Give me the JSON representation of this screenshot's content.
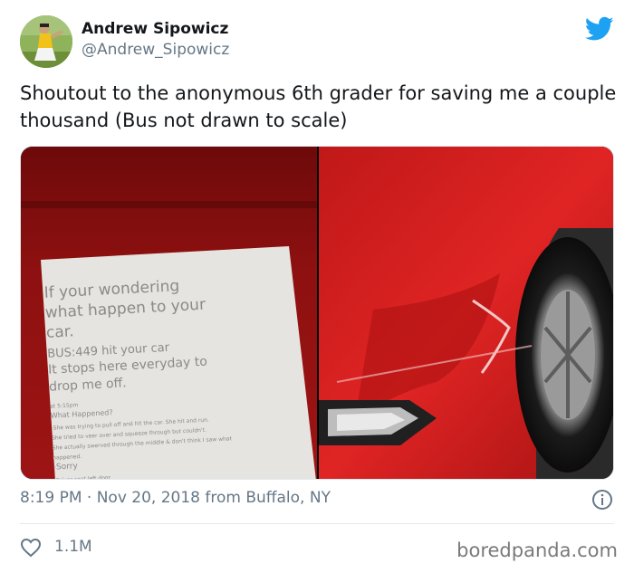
{
  "author": {
    "name": "Andrew Sipowicz",
    "handle": "@Andrew_Sipowicz"
  },
  "tweet": {
    "text": "Shoutout to the anonymous 6th grader for saving me a couple thousand (Bus not drawn to scale)"
  },
  "note": {
    "lines": [
      "If your wondering",
      "what happen to your",
      "car.",
      "BUS:449 hit your car",
      "It stops here everyday to",
      "drop me off.",
      "at 5:15pm",
      "What Happened?",
      "-She was trying to pull off and hit the car. She hit and run.",
      "She tried to veer over and squeeze through but couldn't.",
      "She actually swerved through the middle & don't think I saw what",
      "happened.",
      "-Sorry",
      "-Driver seat left door"
    ]
  },
  "meta": {
    "timestamp": "8:19 PM · Nov 20, 2018 from Buffalo, NY"
  },
  "engagement": {
    "likes": "1.1M"
  },
  "watermark": "boredpanda.com",
  "icons": {
    "twitter_bird": "twitter-bird-icon",
    "info": "info-icon",
    "like": "heart-icon"
  },
  "colors": {
    "twitter_blue": "#1da1f2",
    "secondary_text": "#657786",
    "divider": "#e1e8ed",
    "car_red": "#d81c1c"
  }
}
